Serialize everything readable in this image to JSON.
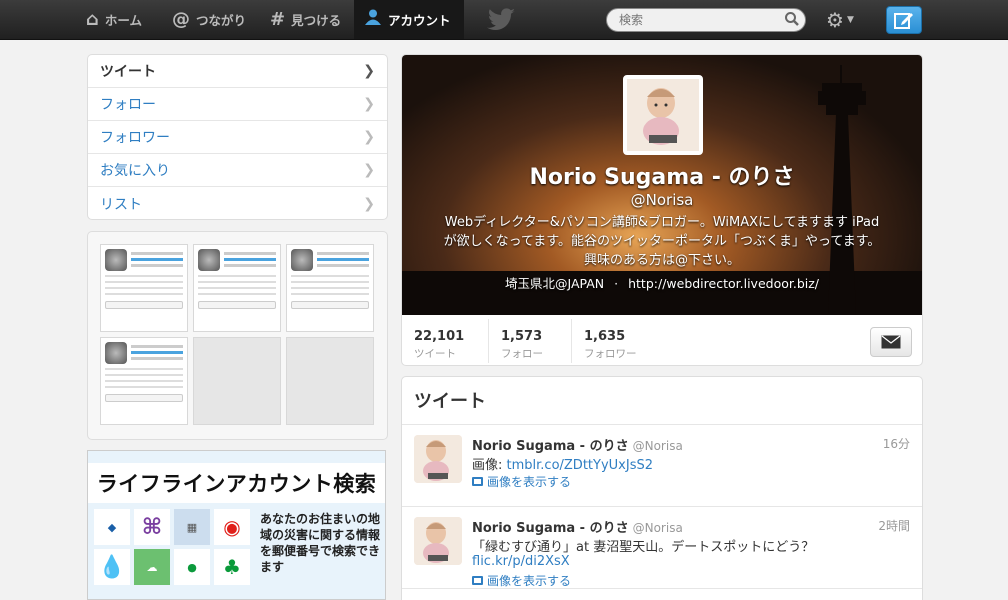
{
  "topbar": {
    "nav": [
      {
        "label": "ホーム",
        "icon": "home-icon"
      },
      {
        "label": "つながり",
        "icon": "at-icon"
      },
      {
        "label": "見つける",
        "icon": "hashtag-icon"
      },
      {
        "label": "アカウント",
        "icon": "user-icon"
      }
    ],
    "search_placeholder": "検索",
    "accent": "#4aa3df"
  },
  "sidebar": {
    "menu": [
      {
        "label": "ツイート",
        "active": true
      },
      {
        "label": "フォロー"
      },
      {
        "label": "フォロワー"
      },
      {
        "label": "お気に入り"
      },
      {
        "label": "リスト"
      }
    ]
  },
  "lifeline": {
    "title": "ライフラインアカウント検索",
    "text": "あなたのお住まいの地域の災害に関する情報を郵便番号で検索できます"
  },
  "profile": {
    "name": "Norio Sugama - のりさ",
    "handle": "@Norisa",
    "bio": "Webディレクター&パソコン講師&ブロガー。WiMAXにしてますます iPadが欲しくなってます。能谷のツイッターポータル「つぶくま」やってます。興味のある方は@下さい。",
    "location": "埼玉県北@JAPAN",
    "url": "http://webdirector.livedoor.biz/",
    "stats": [
      {
        "num": "22,101",
        "label": "ツイート"
      },
      {
        "num": "1,573",
        "label": "フォロー"
      },
      {
        "num": "1,635",
        "label": "フォロワー"
      }
    ]
  },
  "tweets": {
    "heading": "ツイート",
    "items": [
      {
        "name": "Norio Sugama - のりさ",
        "handle": "@Norisa",
        "time": "16分",
        "prefix": "画像: ",
        "link": "tmblr.co/ZDttYyUxJsS2",
        "media": "画像を表示する"
      },
      {
        "name": "Norio Sugama - のりさ",
        "handle": "@Norisa",
        "time": "2時間",
        "text": "「緑むすび通り」at 妻沼聖天山。デートスポットにどう？",
        "link": "flic.kr/p/di2XsX",
        "media": "画像を表示する"
      }
    ]
  }
}
